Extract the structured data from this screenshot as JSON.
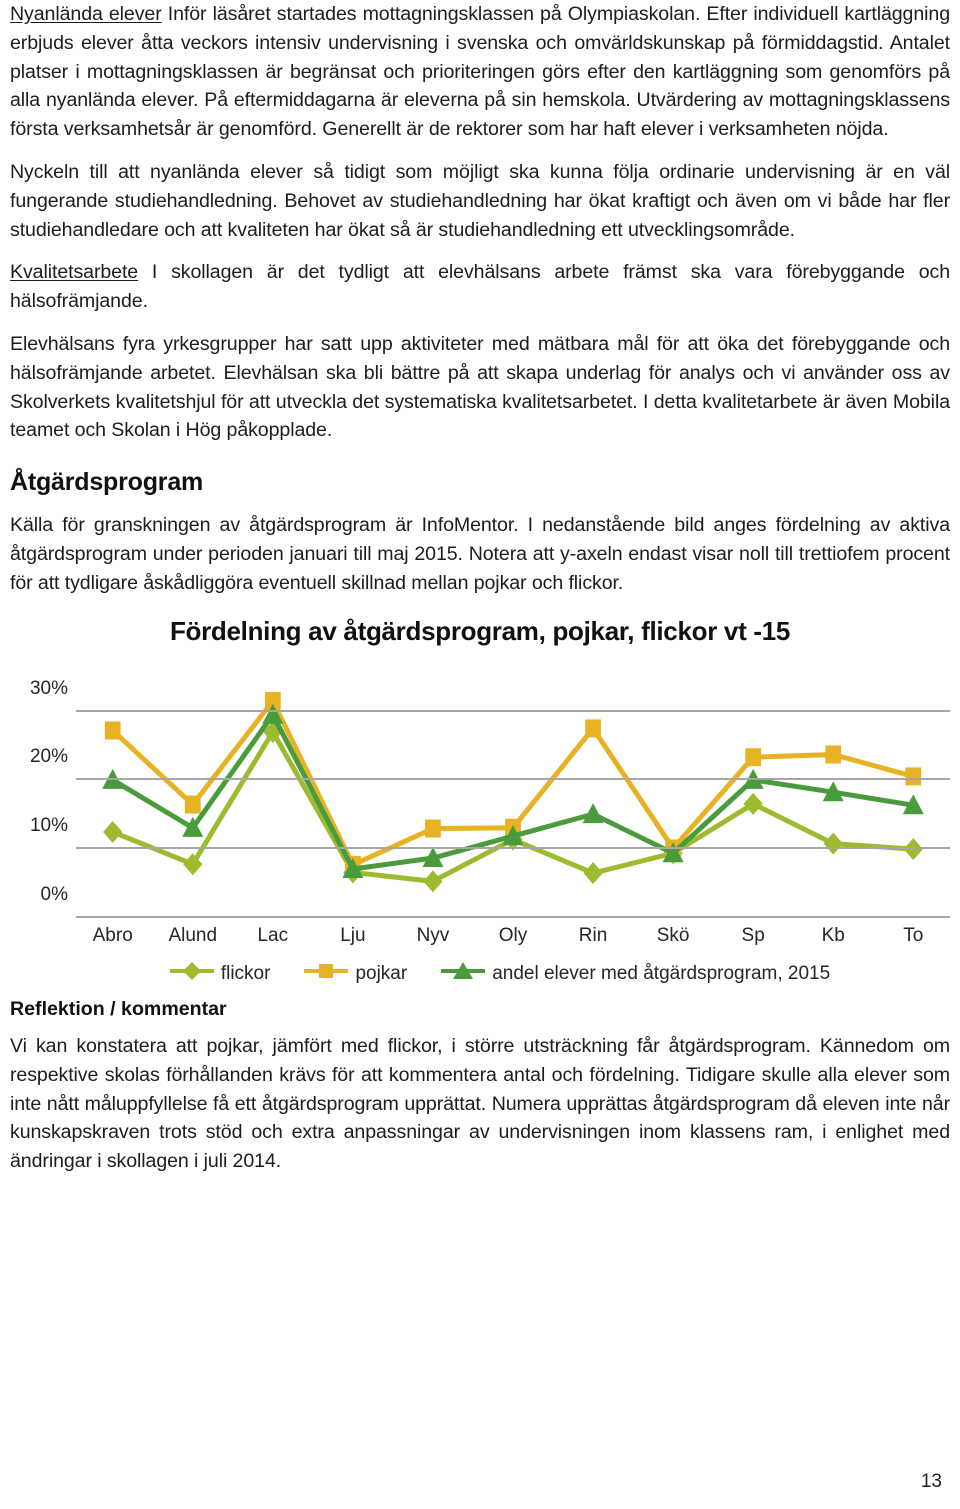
{
  "document": {
    "page_number": "13",
    "paragraphs": [
      {
        "id": "p-nyanlanda",
        "lead": "Nyanlända elever",
        "text": " Inför läsåret startades mottagningsklassen på Olympiaskolan. Efter individuell kartläggning erbjuds elever åtta veckors intensiv undervisning i svenska och omvärldskunskap på förmiddagstid. Antalet platser i mottagningsklassen är begränsat och prioriteringen görs efter den kartläggning som genomförs på alla nyanlända elever. På eftermiddagarna är eleverna på sin hemskola. Utvärdering av mottagningsklassens första verksamhetsår är genomförd. Generellt är de rektorer som har haft elever i verksamheten nöjda."
      },
      {
        "id": "p-nyckeln",
        "lead": "",
        "text": "Nyckeln till att nyanlända elever så tidigt som möjligt ska kunna följa ordinarie undervisning är en väl fungerande studiehandledning. Behovet av studiehandledning har ökat kraftigt och även om vi både har fler studiehandledare och att kvaliteten har ökat så är studiehandledning ett utvecklingsområde."
      },
      {
        "id": "p-kvalitetsarbete",
        "lead": "Kvalitetsarbete",
        "text": " I skollagen är det tydligt att elevhälsans arbete främst ska vara förebyggande och hälsofrämjande."
      },
      {
        "id": "p-elevhalsan",
        "lead": "",
        "text": "Elevhälsans fyra yrkesgrupper har satt upp aktiviteter med mätbara mål för att öka det förebyggande och hälsofrämjande arbetet. Elevhälsan ska bli bättre på att skapa underlag för analys och vi använder oss av Skolverkets kvalitetshjul för att utveckla det systematiska kvalitetsarbetet. I detta kvalitetarbete är även Mobila teamet och Skolan i Hög påkopplade."
      }
    ],
    "atgardsprogram_heading": "Åtgärdsprogram",
    "atgardsprogram_intro": "Källa för granskningen av åtgärdsprogram är InfoMentor. I nedanstående bild anges fördelning av aktiva åtgärdsprogram under perioden januari till maj 2015. Notera att y-axeln endast visar noll till trettiofem procent för att tydligare åskådliggöra eventuell skillnad mellan pojkar och flickor.",
    "reflection_heading": "Reflektion / kommentar",
    "reflection_text": "Vi kan konstatera att pojkar, jämfört med flickor, i större utsträckning får åtgärdsprogram. Kännedom om respektive skolas förhållanden krävs för att kommentera antal och fördelning. Tidigare skulle alla elever som inte nått måluppfyllelse få ett åtgärdsprogram upprättat. Numera upprättas åtgärdsprogram då eleven inte når kunskapskraven trots stöd och extra anpassningar av undervisningen inom klassens ram, i enlighet med ändringar i skollagen i juli 2014."
  },
  "chart_data": {
    "type": "line",
    "title": "Fördelning av åtgärdsprogram, pojkar, flickor vt -15",
    "xlabel": "",
    "ylabel": "",
    "ylim": [
      0,
      35
    ],
    "yticks": [
      0,
      10,
      20,
      30
    ],
    "ytick_labels": [
      "0%",
      "10%",
      "20%",
      "30%"
    ],
    "grid": true,
    "legend_position": "bottom",
    "categories": [
      "Abro",
      "Alund",
      "Lac",
      "Lju",
      "Nyv",
      "Oly",
      "Rin",
      "Skö",
      "Sp",
      "Kb",
      "To"
    ],
    "series": [
      {
        "name": "flickor",
        "color": "#9CBB2E",
        "marker": "diamond",
        "values": [
          12.4,
          7.7,
          27.0,
          6.5,
          5.2,
          11.3,
          6.4,
          9.3,
          16.5,
          10.7,
          9.9
        ]
      },
      {
        "name": "pojkar",
        "color": "#E8B225",
        "marker": "square",
        "values": [
          27.2,
          16.4,
          31.5,
          7.6,
          12.9,
          13.0,
          27.5,
          10.0,
          23.3,
          23.7,
          20.5
        ]
      },
      {
        "name": "andel elever med åtgärdsprogram, 2015",
        "color": "#4A9B3C",
        "marker": "triangle",
        "values": [
          20.0,
          13.0,
          29.5,
          7.0,
          8.6,
          11.8,
          15.0,
          9.3,
          20.0,
          18.2,
          16.3
        ]
      }
    ]
  }
}
